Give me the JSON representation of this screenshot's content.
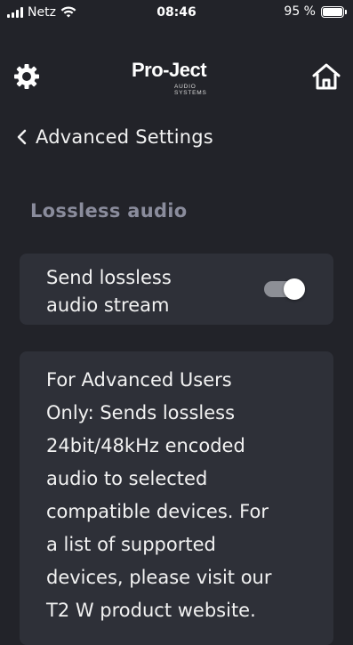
{
  "status_bar": {
    "carrier": "Netz",
    "time": "08:46",
    "battery": "95 %"
  },
  "header": {
    "logo_text": "Pro-Ject",
    "logo_subtext": "AUDIO SYSTEMS"
  },
  "navigation": {
    "back_label": "Advanced Settings"
  },
  "section": {
    "heading": "Lossless audio"
  },
  "toggle_setting": {
    "label_line1": "Send lossless",
    "label_line2": "audio stream",
    "enabled": true
  },
  "info": {
    "lines": [
      "For Advanced Users",
      "Only: Sends lossless",
      "24bit/48kHz encoded",
      "audio to selected",
      "compatible devices. For",
      "a list of supported",
      "devices, please visit our",
      "T2 W product website."
    ]
  },
  "icons": {
    "settings": "gear-icon",
    "home": "home-icon",
    "back": "chevron-left-icon",
    "wifi": "wifi-icon",
    "signal": "signal-icon",
    "battery": "battery-icon"
  }
}
